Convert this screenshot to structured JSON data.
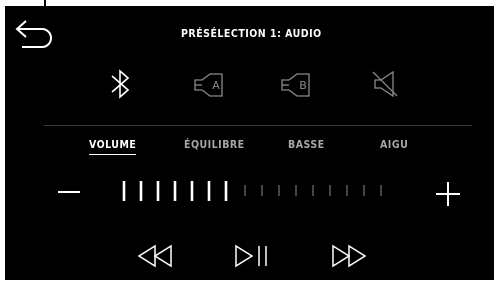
{
  "header": {
    "title": "PRÉSÉLECTION 1: AUDIO"
  },
  "icons": {
    "back": "back-arrow-icon",
    "bluetooth": "bluetooth-icon",
    "speaker_a": "speaker-a-icon",
    "speaker_b": "speaker-b-icon",
    "mute": "mute-icon",
    "minus": "minus-icon",
    "plus": "plus-icon",
    "rewind": "rewind-icon",
    "play_pause": "play-pause-icon",
    "fast_forward": "fast-forward-icon"
  },
  "speaker_labels": {
    "a": "A",
    "b": "B"
  },
  "tabs": [
    {
      "label": "VOLUME",
      "active": true
    },
    {
      "label": "ÉQUILIBRE",
      "active": false
    },
    {
      "label": "BASSE",
      "active": false
    },
    {
      "label": "AIGU",
      "active": false
    }
  ],
  "volume": {
    "level": 7,
    "max": 16
  },
  "colors": {
    "background": "#000000",
    "foreground": "#ffffff",
    "inactive": "#a8a8a8"
  }
}
